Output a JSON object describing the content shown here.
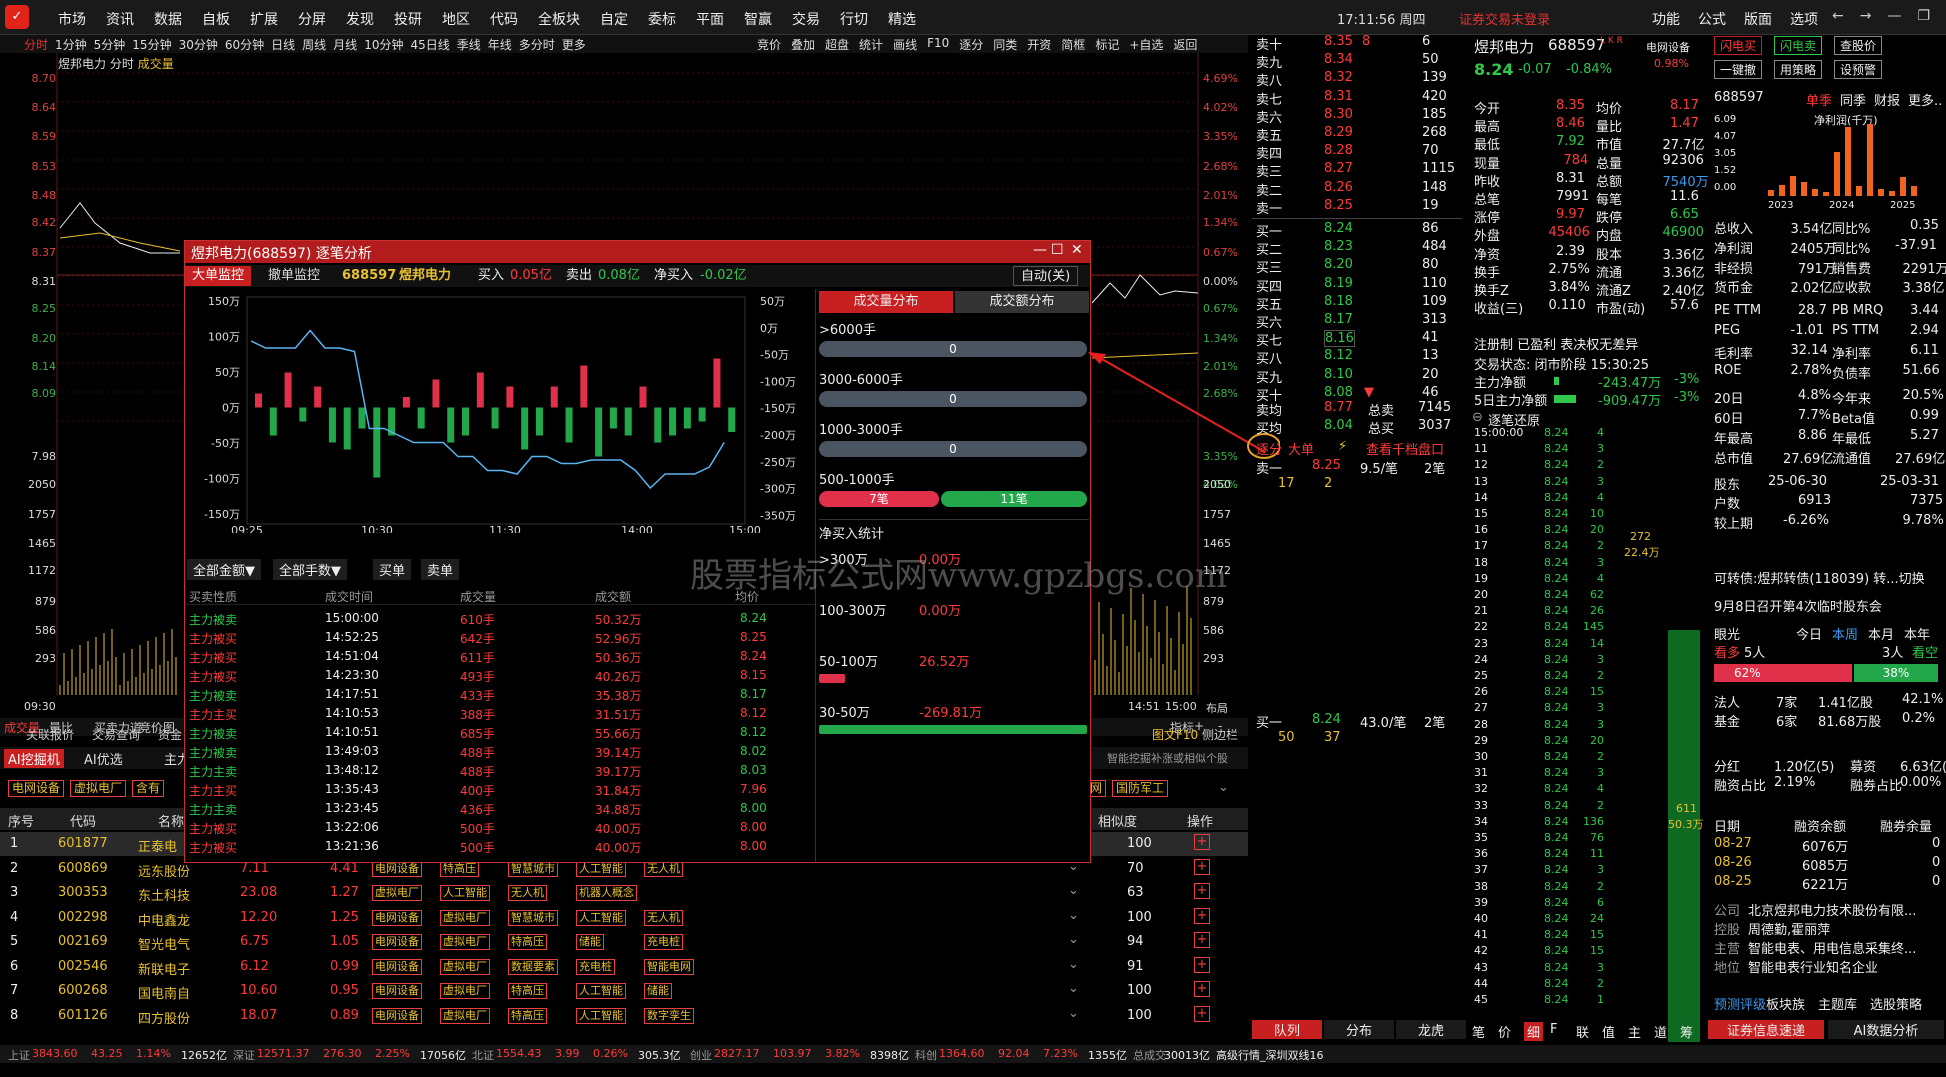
{
  "menu": [
    "市场",
    "资讯",
    "数据",
    "自板",
    "扩展",
    "分屏",
    "发现",
    "投研",
    "地区",
    "代码",
    "全板块",
    "自定",
    "委标",
    "平面",
    "智赢",
    "交易",
    "行切",
    "精选"
  ],
  "clock": "17:11:56 周四",
  "login": "证券交易未登录",
  "rmenu": [
    "功能",
    "公式",
    "版面",
    "选项"
  ],
  "periods": [
    "分时",
    "1分钟",
    "5分钟",
    "15分钟",
    "30分钟",
    "60分钟",
    "日线",
    "周线",
    "月线",
    "10分钟",
    "45日线",
    "季线",
    "年线",
    "多分时",
    "更多"
  ],
  "tools": [
    "竞价",
    "叠加",
    "超盘",
    "统计",
    "画线",
    "F10",
    "逐分",
    "同类",
    "开资",
    "简框",
    "标记",
    "+自选",
    "返回"
  ],
  "chart_title": {
    "name": "煜邦电力",
    "mode": "分时",
    "vol": "成交量"
  },
  "yleft": [
    "8.70",
    "8.64",
    "8.59",
    "8.53",
    "8.48",
    "8.42",
    "8.37",
    "8.31",
    "8.25",
    "8.20",
    "8.14",
    "8.09",
    "7.98",
    "2050",
    "1757",
    "1465",
    "1172",
    "879",
    "586",
    "293"
  ],
  "yright": [
    "4.69%",
    "4.02%",
    "3.35%",
    "2.68%",
    "2.01%",
    "1.34%",
    "0.67%",
    "0.00%",
    "0.67%",
    "1.34%",
    "2.01%",
    "2.68%",
    "3.35%",
    "4.02%",
    "2050",
    "1757",
    "1465",
    "1172",
    "879",
    "586",
    "293"
  ],
  "time_start": "09:30",
  "time_end": [
    "14:51",
    "15:00",
    "布局"
  ],
  "subtabs": [
    "成交量",
    "量比",
    "买卖力道",
    "竞价图"
  ],
  "ind_btns": [
    "指标",
    "+",
    "-"
  ],
  "tabs2": [
    "关联报价",
    "交易查询",
    "资金"
  ],
  "tabs3": [
    "图文F10",
    "侧边栏"
  ],
  "aitabs": [
    "AI挖掘机",
    "AI优选",
    "主力"
  ],
  "ai_hint": "智能挖掘补涨或相似个股",
  "chips": [
    "电网设备",
    "虚拟电厂",
    "含有"
  ],
  "chips_right": [
    "网",
    "国防军工"
  ],
  "tbl_hdr": {
    "no": "序号",
    "code": "代码",
    "name": "名称",
    "sim": "相似度",
    "op": "操作"
  },
  "rows": [
    {
      "no": "1",
      "code": "601877",
      "name": "正泰电",
      "price": "",
      "chg": "",
      "tags": [],
      "sim": "100"
    },
    {
      "no": "2",
      "code": "600869",
      "name": "远东股份",
      "price": "7.11",
      "chg": "4.41",
      "tags": [
        "电网设备",
        "特高压",
        "智慧城市",
        "人工智能",
        "无人机"
      ],
      "sim": "70"
    },
    {
      "no": "3",
      "code": "300353",
      "name": "东土科技",
      "price": "23.08",
      "chg": "1.27",
      "tags": [
        "虚拟电厂",
        "人工智能",
        "无人机",
        "机器人概念"
      ],
      "sim": "63"
    },
    {
      "no": "4",
      "code": "002298",
      "name": "中电鑫龙",
      "price": "12.20",
      "chg": "1.25",
      "tags": [
        "电网设备",
        "虚拟电厂",
        "智慧城市",
        "人工智能",
        "无人机"
      ],
      "sim": "100"
    },
    {
      "no": "5",
      "code": "002169",
      "name": "智光电气",
      "price": "6.75",
      "chg": "1.05",
      "tags": [
        "电网设备",
        "虚拟电厂",
        "特高压",
        "储能",
        "充电桩"
      ],
      "sim": "94"
    },
    {
      "no": "6",
      "code": "002546",
      "name": "新联电子",
      "price": "6.12",
      "chg": "0.99",
      "tags": [
        "电网设备",
        "虚拟电厂",
        "数据要素",
        "充电桩",
        "智能电网"
      ],
      "sim": "91"
    },
    {
      "no": "7",
      "code": "600268",
      "name": "国电南自",
      "price": "10.60",
      "chg": "0.95",
      "tags": [
        "电网设备",
        "虚拟电厂",
        "特高压",
        "人工智能",
        "储能"
      ],
      "sim": "100"
    },
    {
      "no": "8",
      "code": "601126",
      "name": "四方股份",
      "price": "18.07",
      "chg": "0.89",
      "tags": [
        "电网设备",
        "虚拟电厂",
        "特高压",
        "人工智能",
        "数字孪生"
      ],
      "sim": "100"
    }
  ],
  "status": [
    {
      "t": "上证",
      "c": "gry"
    },
    {
      "t": "3843.60",
      "c": "red"
    },
    {
      "t": "43.25",
      "c": "red"
    },
    {
      "t": "1.14%",
      "c": "red"
    },
    {
      "t": "12652亿",
      "c": "wht"
    },
    {
      "t": "深证",
      "c": "gry"
    },
    {
      "t": "12571.37",
      "c": "red"
    },
    {
      "t": "276.30",
      "c": "red"
    },
    {
      "t": "2.25%",
      "c": "red"
    },
    {
      "t": "17056亿",
      "c": "wht"
    },
    {
      "t": "北证",
      "c": "gry"
    },
    {
      "t": "1554.43",
      "c": "red"
    },
    {
      "t": "3.99",
      "c": "red"
    },
    {
      "t": "0.26%",
      "c": "red"
    },
    {
      "t": "305.3亿",
      "c": "wht"
    },
    {
      "t": "创业",
      "c": "gry"
    },
    {
      "t": "2827.17",
      "c": "red"
    },
    {
      "t": "103.97",
      "c": "red"
    },
    {
      "t": "3.82%",
      "c": "red"
    },
    {
      "t": "8398亿",
      "c": "wht"
    },
    {
      "t": "科创",
      "c": "gry"
    },
    {
      "t": "1364.60",
      "c": "red"
    },
    {
      "t": "92.04",
      "c": "red"
    },
    {
      "t": "7.23%",
      "c": "red"
    },
    {
      "t": "1355亿",
      "c": "wht"
    },
    {
      "t": "总成交",
      "c": "gry"
    },
    {
      "t": "30013亿",
      "c": "wht"
    },
    {
      "t": "高级行情_深圳双线16",
      "c": "wht"
    }
  ],
  "popup": {
    "title": "煜邦电力(688597) 逐笔分析",
    "tab_big": "大单监控",
    "tab_cancel": "撤单监控",
    "code": "688597",
    "name": "煜邦电力",
    "buy_label": "买入",
    "buy": "0.05亿",
    "sell_label": "卖出",
    "sell": "0.08亿",
    "net_label": "净买入",
    "net": "-0.02亿",
    "auto": "自动(关)",
    "yleft": [
      "150万",
      "100万",
      "50万",
      "0万",
      "-50万",
      "-100万",
      "-150万"
    ],
    "yright": [
      "50万",
      "0万",
      "-50万",
      "-100万",
      "-150万",
      "-200万",
      "-250万",
      "-300万",
      "-350万"
    ],
    "xticks": [
      "09:25",
      "10:30",
      "11:30",
      "14:00",
      "15:00"
    ],
    "dist_tab1": "成交量分布",
    "dist_tab2": "成交额分布",
    "dist": [
      {
        "label": ">6000手",
        "val": "0"
      },
      {
        "label": "3000-6000手",
        "val": "0"
      },
      {
        "label": "1000-3000手",
        "val": "0"
      },
      {
        "label": "500-1000手",
        "buy": "7笔",
        "sell": "11笔"
      }
    ],
    "net_title": "净买入统计",
    "net_rows": [
      {
        "label": ">300万",
        "val": "0.00万"
      },
      {
        "label": "100-300万",
        "val": "0.00万"
      },
      {
        "label": "50-100万",
        "val": "26.52万"
      },
      {
        "label": "30-50万",
        "val": "-269.81万"
      }
    ],
    "filters": [
      "全部金额▼",
      "全部手数▼",
      "买单",
      "卖单"
    ],
    "thdr": [
      "买卖性质",
      "成交时间",
      "成交量",
      "成交额",
      "均价"
    ],
    "trades": [
      [
        "主力被卖",
        "15:00:00",
        "610手",
        "50.32万",
        "8.24",
        "g"
      ],
      [
        "主力被买",
        "14:52:25",
        "642手",
        "52.96万",
        "8.25",
        "r"
      ],
      [
        "主力被买",
        "14:51:04",
        "611手",
        "50.36万",
        "8.24",
        "r"
      ],
      [
        "主力被买",
        "14:23:30",
        "493手",
        "40.26万",
        "8.15",
        "r"
      ],
      [
        "主力被卖",
        "14:17:51",
        "433手",
        "35.38万",
        "8.17",
        "g"
      ],
      [
        "主力主买",
        "14:10:53",
        "388手",
        "31.51万",
        "8.12",
        "r"
      ],
      [
        "主力被卖",
        "14:10:51",
        "685手",
        "55.66万",
        "8.12",
        "g"
      ],
      [
        "主力被卖",
        "13:49:03",
        "488手",
        "39.14万",
        "8.02",
        "g"
      ],
      [
        "主力主卖",
        "13:48:12",
        "488手",
        "39.17万",
        "8.03",
        "g"
      ],
      [
        "主力主买",
        "13:35:43",
        "400手",
        "31.84万",
        "7.96",
        "r"
      ],
      [
        "主力主卖",
        "13:23:45",
        "436手",
        "34.88万",
        "8.00",
        "g"
      ],
      [
        "主力被买",
        "13:22:06",
        "500手",
        "40.00万",
        "8.00",
        "r"
      ],
      [
        "主力被买",
        "13:21:36",
        "500手",
        "40.00万",
        "8.00",
        "r"
      ]
    ],
    "bars": [
      20,
      -40,
      50,
      -20,
      30,
      -50,
      -60,
      -30,
      -100,
      -40,
      15,
      -30,
      40,
      -50,
      -40,
      50,
      -30,
      30,
      -60,
      -40,
      30,
      -50,
      60,
      -70,
      -30,
      -40,
      30,
      -50,
      -40,
      -30,
      -20,
      70,
      -35
    ],
    "line": [
      95,
      85,
      85,
      85,
      110,
      85,
      85,
      80,
      -30,
      -30,
      -40,
      -50,
      -50,
      -50,
      -70,
      -70,
      -90,
      -90,
      -95,
      -70,
      -70,
      -80,
      -80,
      -75,
      -75,
      -75,
      -90,
      -115,
      -95,
      -95,
      -95,
      -85,
      -50
    ]
  },
  "orderbook": {
    "sells": [
      {
        "l": "卖十",
        "p": "8.35",
        "v": "6",
        "x": "8"
      },
      {
        "l": "卖九",
        "p": "8.34",
        "v": "50",
        "x": ""
      },
      {
        "l": "卖八",
        "p": "8.32",
        "v": "139",
        "x": ""
      },
      {
        "l": "卖七",
        "p": "8.31",
        "v": "420",
        "x": ""
      },
      {
        "l": "卖六",
        "p": "8.30",
        "v": "185",
        "x": ""
      },
      {
        "l": "卖五",
        "p": "8.29",
        "v": "268",
        "x": ""
      },
      {
        "l": "卖四",
        "p": "8.28",
        "v": "70",
        "x": ""
      },
      {
        "l": "卖三",
        "p": "8.27",
        "v": "1115",
        "x": ""
      },
      {
        "l": "卖二",
        "p": "8.26",
        "v": "148",
        "x": ""
      },
      {
        "l": "卖一",
        "p": "8.25",
        "v": "19",
        "x": ""
      }
    ],
    "buys": [
      {
        "l": "买一",
        "p": "8.24",
        "v": "86"
      },
      {
        "l": "买二",
        "p": "8.23",
        "v": "484"
      },
      {
        "l": "买三",
        "p": "8.20",
        "v": "80"
      },
      {
        "l": "买四",
        "p": "8.19",
        "v": "110"
      },
      {
        "l": "买五",
        "p": "8.18",
        "v": "109"
      },
      {
        "l": "买六",
        "p": "8.17",
        "v": "313"
      },
      {
        "l": "买七",
        "p": "8.16",
        "v": "41"
      },
      {
        "l": "买八",
        "p": "8.12",
        "v": "13"
      },
      {
        "l": "买九",
        "p": "8.10",
        "v": "20"
      },
      {
        "l": "买十",
        "p": "8.08",
        "v": "46"
      }
    ],
    "avg_s_l": "卖均",
    "avg_s": "8.77",
    "tot_s_l": "总卖",
    "tot_s": "7145",
    "avg_b_l": "买均",
    "avg_b": "8.04",
    "tot_b_l": "总买",
    "tot_b": "3037",
    "tabs": [
      "逐分",
      "大单",
      "查看千档盘口"
    ],
    "q1": {
      "l": "卖一",
      "p": "8.25",
      "a": "9.5/笔",
      "n": "2笔"
    },
    "q1v": [
      "17",
      "2"
    ],
    "q2": {
      "l": "买一",
      "p": "8.24",
      "a": "43.0/笔",
      "n": "2笔"
    },
    "q2v": [
      "50",
      "37"
    ],
    "bottom_tabs": [
      "队列",
      "分布",
      "龙虎"
    ]
  },
  "stock": {
    "name": "煜邦电力",
    "code": "688597",
    "tags": "L K R",
    "sector": "电网设备",
    "sector_chg": "0.98%",
    "price": "8.24",
    "chg": "-0.07",
    "pct": "-0.84%",
    "kv": [
      [
        "今开",
        "8.35",
        "均价",
        "8.17"
      ],
      [
        "最高",
        "8.46",
        "量比",
        "1.47"
      ],
      [
        "最低",
        "7.92",
        "市值",
        "27.7亿"
      ],
      [
        "现量",
        "784",
        "总量",
        "92306"
      ],
      [
        "昨收",
        "8.31",
        "总额",
        "7540万"
      ],
      [
        "总笔",
        "7991",
        "每笔",
        "11.6"
      ],
      [
        "涨停",
        "9.97",
        "跌停",
        "6.65"
      ],
      [
        "外盘",
        "45406",
        "内盘",
        "46900"
      ],
      [
        "净资",
        "2.39",
        "股本",
        "3.36亿"
      ],
      [
        "换手",
        "2.75%",
        "流通",
        "3.36亿"
      ],
      [
        "换手Z",
        "3.84%",
        "流通Z",
        "2.40亿"
      ],
      [
        "收益(三)",
        "0.110",
        "市盈(动)",
        "57.6"
      ]
    ],
    "note": "注册制 已盈利 表决权无差异",
    "state": "交易状态: 闭市阶段 15:30:25",
    "net1_l": "主力净额",
    "net1": "-243.47万",
    "net1p": "-3%",
    "net2_l": "5日主力净额",
    "net2": "-909.47万",
    "net2p": "-3%",
    "ticks_title": "逐笔还原",
    "ticks": [
      [
        "15:00:00",
        "8.24",
        "4"
      ],
      [
        "11",
        "8.24",
        "3"
      ],
      [
        "12",
        "8.24",
        "2"
      ],
      [
        "13",
        "8.24",
        "3"
      ],
      [
        "14",
        "8.24",
        "4"
      ],
      [
        "15",
        "8.24",
        "10"
      ],
      [
        "16",
        "8.24",
        "20"
      ],
      [
        "17",
        "8.24",
        "2"
      ],
      [
        "18",
        "8.24",
        "3"
      ],
      [
        "19",
        "8.24",
        "4"
      ],
      [
        "20",
        "8.24",
        "62"
      ],
      [
        "21",
        "8.24",
        "26"
      ],
      [
        "22",
        "8.24",
        "145"
      ],
      [
        "23",
        "8.24",
        "14"
      ],
      [
        "24",
        "8.24",
        "3"
      ],
      [
        "25",
        "8.24",
        "2"
      ],
      [
        "26",
        "8.24",
        "15"
      ],
      [
        "27",
        "8.24",
        "3"
      ],
      [
        "28",
        "8.24",
        "3"
      ],
      [
        "29",
        "8.24",
        "20"
      ],
      [
        "30",
        "8.24",
        "2"
      ],
      [
        "31",
        "8.24",
        "3"
      ],
      [
        "32",
        "8.24",
        "4"
      ],
      [
        "33",
        "8.24",
        "2"
      ],
      [
        "34",
        "8.24",
        "136"
      ],
      [
        "35",
        "8.24",
        "76"
      ],
      [
        "36",
        "8.24",
        "11"
      ],
      [
        "37",
        "8.24",
        "3"
      ],
      [
        "38",
        "8.24",
        "2"
      ],
      [
        "39",
        "8.24",
        "6"
      ],
      [
        "40",
        "8.24",
        "24"
      ],
      [
        "41",
        "8.24",
        "15"
      ],
      [
        "42",
        "8.24",
        "15"
      ],
      [
        "43",
        "8.24",
        "3"
      ],
      [
        "44",
        "8.24",
        "2"
      ],
      [
        "45",
        "8.24",
        "1"
      ]
    ],
    "tick_side": [
      [
        "272",
        "22.4万"
      ],
      [
        "611",
        "50.3万"
      ]
    ],
    "bottom_tabs": [
      "笔",
      "价",
      "细",
      "F",
      "联",
      "值",
      "主",
      "道",
      "筹"
    ]
  },
  "fin": {
    "btns": [
      "闪电买",
      "闪电卖",
      "查股价",
      "一键撤",
      "用策略",
      "设预警"
    ],
    "code": "688597",
    "tabs": [
      "单季",
      "同季",
      "财报",
      "更多.."
    ],
    "chart_title": "净利润(千万)",
    "yaxis": [
      "6.09",
      "4.07",
      "3.05",
      "1.52",
      "0.00"
    ],
    "years": [
      "2023",
      "2024",
      "2025"
    ],
    "bars": [
      0.5,
      0.9,
      1.6,
      1.1,
      0.6,
      0.3,
      3.5,
      5.5,
      0.8,
      5.8,
      0.6,
      0.4,
      1.5,
      0.8
    ],
    "kv": [
      [
        "总收入",
        "3.54亿",
        "同比%",
        "0.35"
      ],
      [
        "净利润",
        "2405万",
        "同比%",
        "-37.91"
      ],
      [
        "非经损",
        "791万",
        "销售费",
        "2291万"
      ],
      [
        "货币金",
        "2.02亿",
        "应收款",
        "3.38亿"
      ],
      [
        "PE TTM",
        "28.7",
        "PB MRQ",
        "3.44"
      ],
      [
        "PEG",
        "-1.01",
        "PS TTM",
        "2.94"
      ],
      [
        "毛利率",
        "32.14",
        "净利率",
        "6.11"
      ],
      [
        "ROE",
        "2.78%",
        "负债率",
        "51.66"
      ],
      [
        "20日",
        "4.8%",
        "今年来",
        "20.5%"
      ],
      [
        "60日",
        "7.7%",
        "Beta值",
        "0.99"
      ],
      [
        "年最高",
        "8.86",
        "年最低",
        "5.27"
      ],
      [
        "总市值",
        "27.69亿",
        "流通值",
        "27.69亿"
      ],
      [
        "股东",
        "25-06-30",
        "",
        "25-03-31"
      ],
      [
        "户数",
        "6913",
        "",
        "7375"
      ],
      [
        "较上期",
        "-6.26%",
        "",
        "9.78%"
      ]
    ],
    "convert": "可转债:煜邦转债(118039) 转...切换",
    "notice": "9月8日召开第4次临时股东会",
    "view_l": "眼光",
    "view_tabs": [
      "今日",
      "本周",
      "本月",
      "本年"
    ],
    "bull": "看多",
    "bull_n": "5人",
    "bear_n": "3人",
    "bear": "看空",
    "bull_p": "62%",
    "bear_p": "38%",
    "inst": [
      [
        "法人",
        "7家",
        "1.41亿股",
        "42.1%"
      ],
      [
        "基金",
        "6家",
        "81.68万股",
        "0.2%"
      ]
    ],
    "div": [
      [
        "分红",
        "1.20亿(5)",
        "募资",
        "6.63亿(2)"
      ],
      [
        "融资占比",
        "2.19%",
        "融券占比",
        "0.00%"
      ]
    ],
    "margin_hdr": [
      "日期",
      "融资余额",
      "融券余量"
    ],
    "margin": [
      [
        "08-27",
        "6076万",
        "0"
      ],
      [
        "08-26",
        "6085万",
        "0"
      ],
      [
        "08-25",
        "6221万",
        "0"
      ]
    ],
    "company": [
      [
        "公司",
        "北京煜邦电力技术股份有限..."
      ],
      [
        "控股",
        "周德勤,霍丽萍"
      ],
      [
        "主营",
        "智能电表、用电信息采集终..."
      ],
      [
        "地位",
        "智能电表行业知名企业"
      ]
    ],
    "links": [
      "预测评级",
      "板块族",
      "主题库",
      "选股策略"
    ],
    "bottom": [
      "证券信息速递",
      "AI数据分析"
    ]
  },
  "watermark": "股票指标公式网www.gpzbgs.com"
}
